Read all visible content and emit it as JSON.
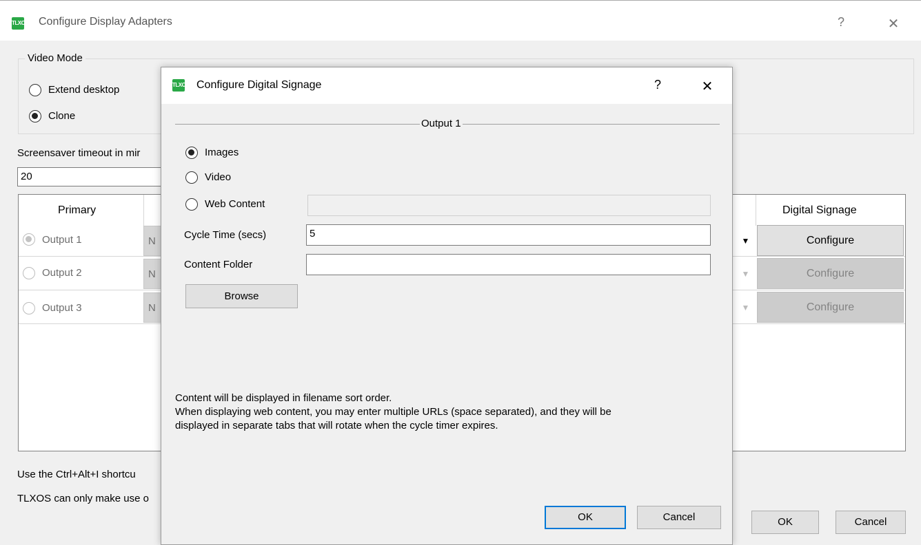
{
  "outer": {
    "icon_text": "TLXOS",
    "title": "Configure Display Adapters",
    "help_glyph": "?",
    "close_glyph": "✕",
    "video_mode": {
      "legend": "Video Mode",
      "extend_label": "Extend desktop",
      "clone_label": "Clone"
    },
    "screensaver_label": "Screensaver timeout in mir",
    "screensaver_value": "20",
    "table": {
      "col_primary": "Primary",
      "col_digital_signage": "Digital Signage",
      "rows": [
        {
          "label": "Output 1",
          "combo": "N",
          "configure": "Configure"
        },
        {
          "label": "Output 2",
          "combo": "N",
          "configure": "Configure"
        },
        {
          "label": "Output 3",
          "combo": "N",
          "configure": "Configure"
        }
      ],
      "arrow_glyph": "▼"
    },
    "footer_line1": "Use the Ctrl+Alt+I shortcu",
    "footer_line2": "TLXOS can only make use o",
    "ok_label": "OK",
    "cancel_label": "Cancel"
  },
  "dialog": {
    "icon_text": "TLXOS",
    "title": "Configure Digital Signage",
    "help_glyph": "?",
    "close_glyph": "✕",
    "group_title": "Output 1",
    "images_label": "Images",
    "video_label": "Video",
    "web_content_label": "Web Content",
    "web_content_value": "",
    "cycle_time_label": "Cycle Time (secs)",
    "cycle_time_value": "5",
    "content_folder_label": "Content Folder",
    "content_folder_value": "",
    "browse_label": "Browse",
    "note_line1": "Content will be displayed in filename sort order.",
    "note_line2": "When displaying web content, you may enter multiple URLs (space separated), and they will be",
    "note_line3": "displayed in separate tabs that will rotate when the cycle timer expires.",
    "ok_label": "OK",
    "cancel_label": "Cancel"
  }
}
